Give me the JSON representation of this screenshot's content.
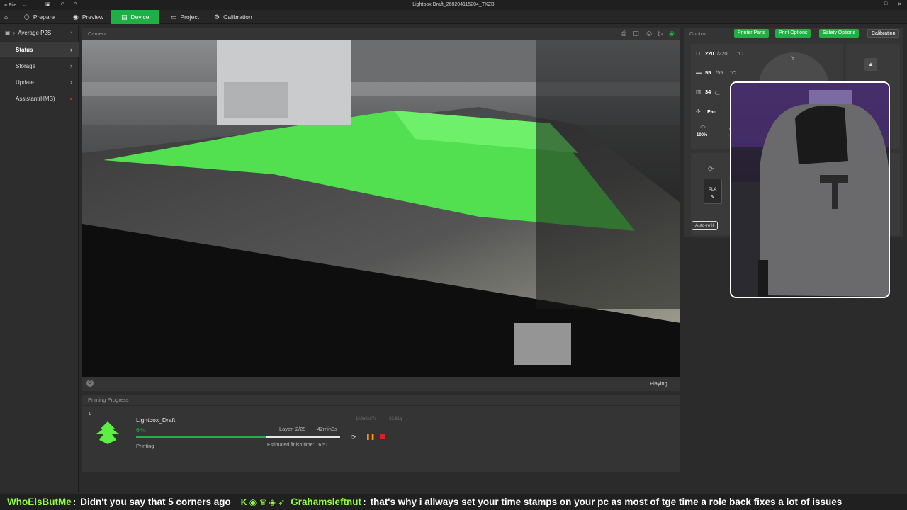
{
  "titlebar": {
    "file_menu": "File",
    "window_title": "Lightbox Draft_260204115204_TKZB"
  },
  "tabs": [
    {
      "label": "Prepare"
    },
    {
      "label": "Preview"
    },
    {
      "label": "Device"
    },
    {
      "label": "Project"
    },
    {
      "label": "Calibration"
    }
  ],
  "sidebar": {
    "printer_name": "Average P2S",
    "items": [
      {
        "label": "Status"
      },
      {
        "label": "Storage"
      },
      {
        "label": "Update"
      },
      {
        "label": "Assistant(HMS)"
      }
    ]
  },
  "camera": {
    "title": "Camera",
    "status": "Playing..."
  },
  "progress": {
    "title": "Printing Progress",
    "plate": "1",
    "job_name": "Lightbox_Draft",
    "percent": "64",
    "percent_unit": "%",
    "percent_value": 64,
    "layer": "Layer: 2/29",
    "remaining": "-42min0s",
    "state": "Printing",
    "finish": "Estimated finish time: 16:51",
    "print_time": "1h9min27s",
    "weight": "33.81g"
  },
  "control": {
    "title": "Control",
    "buttons": [
      "Printer Parts",
      "Print Options",
      "Safety Options",
      "Calibration"
    ],
    "nozzle_temp": "220",
    "nozzle_target": "/220",
    "bed_temp": "55",
    "bed_target": "/55",
    "chamber_temp": "34",
    "chamber_target": "/_",
    "unit": "°C",
    "fan_label": "Fan",
    "fan_speed": "100%",
    "lamp_label": "Lar",
    "filament": "PLA",
    "auto_refill": "Auto-refill",
    "axis_label": "Y"
  },
  "chat": [
    {
      "user": "WhoElsButMe",
      "sep": ":",
      "msg": "Didn't you say that 5 corners ago"
    },
    {
      "user": "Grahamsleftnut",
      "sep": ":",
      "msg": "that's why i allways set your time stamps on your pc as most of tge time a role back fixes a lot of issues"
    }
  ],
  "colors": {
    "accent": "#1fb045",
    "chat_user": "#8fff3a",
    "pause": "#f0a000",
    "stop": "#e02020"
  }
}
